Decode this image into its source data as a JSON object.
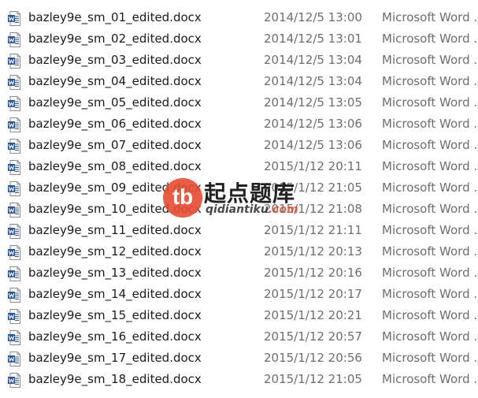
{
  "files": [
    {
      "name": "bazley9e_sm_01_edited.docx",
      "date": "2014/12/5 13:00",
      "type": "Microsoft Word ..."
    },
    {
      "name": "bazley9e_sm_02_edited.docx",
      "date": "2014/12/5 13:01",
      "type": "Microsoft Word ..."
    },
    {
      "name": "bazley9e_sm_03_edited.docx",
      "date": "2014/12/5 13:04",
      "type": "Microsoft Word ..."
    },
    {
      "name": "bazley9e_sm_04_edited.docx",
      "date": "2014/12/5 13:04",
      "type": "Microsoft Word ..."
    },
    {
      "name": "bazley9e_sm_05_edited.docx",
      "date": "2014/12/5 13:05",
      "type": "Microsoft Word ..."
    },
    {
      "name": "bazley9e_sm_06_edited.docx",
      "date": "2014/12/5 13:06",
      "type": "Microsoft Word ..."
    },
    {
      "name": "bazley9e_sm_07_edited.docx",
      "date": "2014/12/5 13:06",
      "type": "Microsoft Word ..."
    },
    {
      "name": "bazley9e_sm_08_edited.docx",
      "date": "2015/1/12 20:11",
      "type": "Microsoft Word ..."
    },
    {
      "name": "bazley9e_sm_09_edited.docx",
      "date": "2015/1/12 21:05",
      "type": "Microsoft Word ..."
    },
    {
      "name": "bazley9e_sm_10_edited.docx",
      "date": "2015/1/12 21:08",
      "type": "Microsoft Word ..."
    },
    {
      "name": "bazley9e_sm_11_edited.docx",
      "date": "2015/1/12 21:11",
      "type": "Microsoft Word ..."
    },
    {
      "name": "bazley9e_sm_12_edited.docx",
      "date": "2015/1/12 20:13",
      "type": "Microsoft Word ..."
    },
    {
      "name": "bazley9e_sm_13_edited.docx",
      "date": "2015/1/12 20:16",
      "type": "Microsoft Word ..."
    },
    {
      "name": "bazley9e_sm_14_edited.docx",
      "date": "2015/1/12 20:17",
      "type": "Microsoft Word ..."
    },
    {
      "name": "bazley9e_sm_15_edited.docx",
      "date": "2015/1/12 20:21",
      "type": "Microsoft Word ..."
    },
    {
      "name": "bazley9e_sm_16_edited.docx",
      "date": "2015/1/12 20:57",
      "type": "Microsoft Word ..."
    },
    {
      "name": "bazley9e_sm_17_edited.docx",
      "date": "2015/1/12 20:56",
      "type": "Microsoft Word ..."
    },
    {
      "name": "bazley9e_sm_18_edited.docx",
      "date": "2015/1/12 21:05",
      "type": "Microsoft Word ..."
    }
  ],
  "file_icon": "word-document-icon",
  "colors": {
    "word_blue": "#2b579a",
    "watermark_red": "#e84a2f"
  },
  "watermark": {
    "badge": "tb",
    "title": "起点题库",
    "url_main": "qidiantiku",
    "url_suffix": ".com"
  }
}
